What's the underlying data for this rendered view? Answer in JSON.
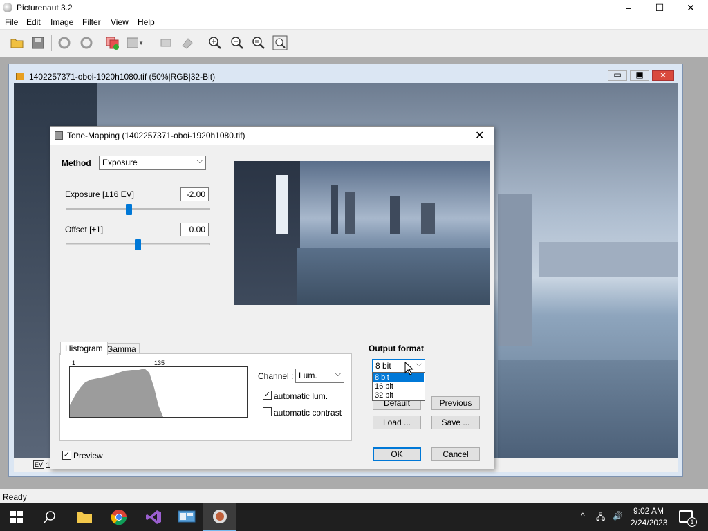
{
  "app": {
    "title": "Picturenaut 3.2",
    "controls": {
      "minimize": "–",
      "maximize": "☐",
      "close": "✕"
    }
  },
  "menu": [
    "File",
    "Edit",
    "Image",
    "Filter",
    "View",
    "Help"
  ],
  "toolbar": {
    "icons": [
      "open-folder-icon",
      "save-icon",
      "undo-icon",
      "redo-icon",
      "layers-icon",
      "adjust-icon",
      "crop-icon",
      "rotate-icon",
      "zoom-in-icon",
      "zoom-out-icon",
      "zoom-fit-icon",
      "zoom-actual-icon"
    ]
  },
  "child_window": {
    "title": "1402257371-oboi-1920h1080.tif (50%|RGB|32-Bit)",
    "status_ev": "EV",
    "status_value": "1"
  },
  "dialog": {
    "title": "Tone-Mapping (1402257371-oboi-1920h1080.tif)",
    "method_label": "Method",
    "method_value": "Exposure",
    "exposure_label": "Exposure [±16 EV]",
    "exposure_value": "-2.00",
    "offset_label": "Offset [±1]",
    "offset_value": "0.00",
    "tabs": [
      "Histogram",
      "Gamma"
    ],
    "hist_min": "1",
    "hist_max": "135",
    "channel_label": "Channel :",
    "channel_value": "Lum.",
    "auto_lum_label": "automatic lum.",
    "auto_lum_checked": true,
    "auto_contrast_label": "automatic contrast",
    "auto_contrast_checked": false,
    "output_format_label": "Output format",
    "output_format_value": "8 bit",
    "output_options": [
      "8 bit",
      "16 bit",
      "32 bit"
    ],
    "buttons": {
      "default": "Default",
      "previous": "Previous",
      "load": "Load ...",
      "save": "Save ...",
      "ok": "OK",
      "cancel": "Cancel"
    },
    "preview_label": "Preview",
    "preview_checked": true
  },
  "status": "Ready",
  "taskbar": {
    "apps": [
      "start-icon",
      "search-icon",
      "file-explorer-icon",
      "chrome-icon",
      "visual-studio-icon",
      "control-panel-icon",
      "picturenaut-icon"
    ],
    "time": "9:02 AM",
    "date": "2/24/2023",
    "notification_count": "1"
  },
  "colors": {
    "accent": "#0078d7",
    "taskbar": "#1f1f1f",
    "selection": "#0078d7"
  }
}
